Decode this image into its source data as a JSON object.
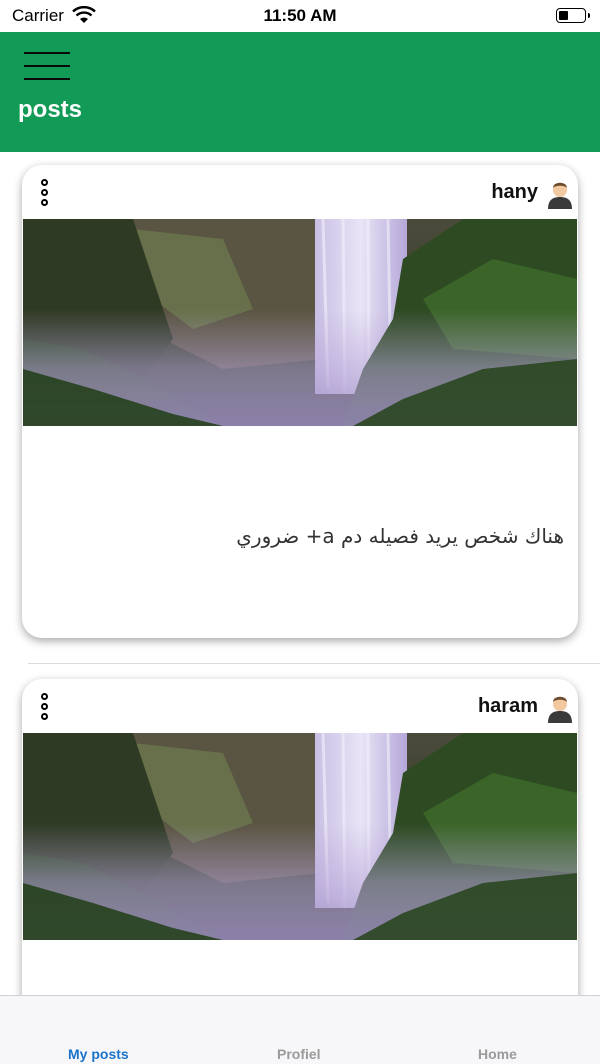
{
  "status_bar": {
    "carrier": "Carrier",
    "time": "11:50 AM"
  },
  "app_bar": {
    "title": "posts",
    "color": "#129b57",
    "menu_icon": "hamburger-menu-icon"
  },
  "posts": [
    {
      "author": "hany",
      "avatar_icon": "user-avatar-icon",
      "more_icon": "more-options-icon",
      "image": "waterfall-photo",
      "text": "هناك شخص يريد فصيله دم a+ ضروري"
    },
    {
      "author": "haram",
      "avatar_icon": "user-avatar-icon",
      "more_icon": "more-options-icon",
      "image": "waterfall-photo"
    }
  ],
  "tab_bar": {
    "active": "My posts",
    "active_color": "#1a73c9",
    "items": [
      "My posts",
      "Profiel",
      "Home"
    ]
  }
}
